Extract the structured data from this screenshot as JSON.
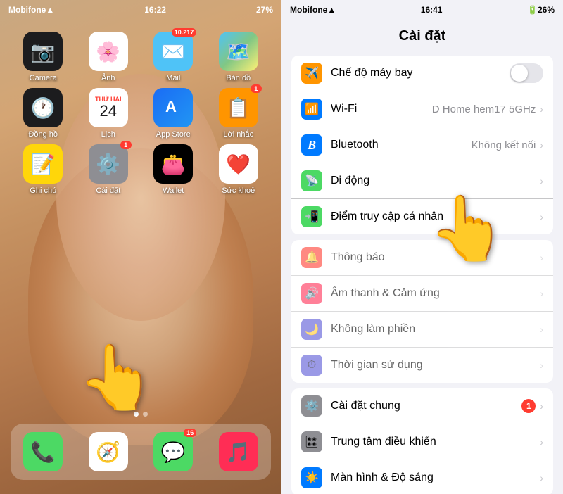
{
  "left": {
    "status": {
      "carrier": "Mobifone",
      "time": "16:22",
      "battery": "27%"
    },
    "apps_row1": [
      {
        "name": "Camera",
        "icon": "📷",
        "style": "icon-camera",
        "badge": ""
      },
      {
        "name": "Ảnh",
        "icon": "🌸",
        "style": "icon-photos",
        "badge": ""
      },
      {
        "name": "Mail",
        "icon": "✉️",
        "style": "icon-mail",
        "badge": "10.217"
      },
      {
        "name": "Bản đồ",
        "icon": "🗺️",
        "style": "icon-maps",
        "badge": ""
      }
    ],
    "apps_row2": [
      {
        "name": "Đồng hồ",
        "icon": "🕐",
        "style": "icon-clock",
        "badge": ""
      },
      {
        "name": "Lịch",
        "icon": "📅",
        "style": "icon-calendar",
        "badge": ""
      },
      {
        "name": "App Store",
        "icon": "🅰",
        "style": "icon-appstore",
        "badge": ""
      },
      {
        "name": "Lời nhắc",
        "icon": "📋",
        "style": "icon-reminders",
        "badge": "1"
      }
    ],
    "apps_row3": [
      {
        "name": "Ghi chú",
        "icon": "📝",
        "style": "icon-notes",
        "badge": ""
      },
      {
        "name": "Cài đặt",
        "icon": "⚙️",
        "style": "icon-settings",
        "badge": "1"
      },
      {
        "name": "Wallet",
        "icon": "👛",
        "style": "icon-wallet",
        "badge": ""
      },
      {
        "name": "Sức khoẻ",
        "icon": "❤️",
        "style": "icon-health",
        "badge": ""
      }
    ],
    "dock": [
      {
        "name": "Phone",
        "icon": "📞",
        "style": "dock-phone",
        "badge": ""
      },
      {
        "name": "Safari",
        "icon": "🧭",
        "style": "dock-safari",
        "badge": ""
      },
      {
        "name": "Messages",
        "icon": "💬",
        "style": "dock-messages",
        "badge": "16"
      },
      {
        "name": "Music",
        "icon": "🎵",
        "style": "dock-music",
        "badge": ""
      }
    ]
  },
  "right": {
    "status": {
      "carrier": "Mobifone",
      "time": "16:41",
      "battery": "26%"
    },
    "title": "Cài đặt",
    "sections": [
      {
        "rows": [
          {
            "icon": "✈️",
            "iconStyle": "ic-airplane",
            "label": "Chế độ máy bay",
            "value": "",
            "type": "toggle"
          },
          {
            "icon": "📶",
            "iconStyle": "ic-wifi",
            "label": "Wi-Fi",
            "value": "D Home hem17 5GHz",
            "type": "nav"
          },
          {
            "icon": "🔵",
            "iconStyle": "ic-bluetooth",
            "label": "Bluetooth",
            "value": "Không kết nối",
            "type": "nav"
          },
          {
            "icon": "📡",
            "iconStyle": "ic-cellular",
            "label": "Di động",
            "value": "",
            "type": "nav"
          },
          {
            "icon": "📲",
            "iconStyle": "ic-hotspot",
            "label": "Điểm truy cập cá nhân",
            "value": "",
            "type": "nav"
          }
        ]
      },
      {
        "rows": [
          {
            "icon": "🔔",
            "iconStyle": "ic-notifications",
            "label": "Thông báo",
            "value": "",
            "type": "nav"
          },
          {
            "icon": "🔊",
            "iconStyle": "ic-sounds",
            "label": "Âm thanh & Cảm ứng",
            "value": "",
            "type": "nav"
          },
          {
            "icon": "🌙",
            "iconStyle": "ic-focus",
            "label": "Không làm phiền",
            "value": "",
            "type": "nav"
          },
          {
            "icon": "⏱",
            "iconStyle": "ic-screentime",
            "label": "Thời gian sử dụng",
            "value": "",
            "type": "nav"
          }
        ]
      },
      {
        "rows": [
          {
            "icon": "⚙️",
            "iconStyle": "ic-general",
            "label": "Cài đặt chung",
            "value": "",
            "type": "nav",
            "badge": "1"
          },
          {
            "icon": "🎛",
            "iconStyle": "ic-control",
            "label": "Trung tâm điều khiển",
            "value": "",
            "type": "nav"
          },
          {
            "icon": "☀️",
            "iconStyle": "ic-display",
            "label": "Màn hình & Độ sáng",
            "value": "",
            "type": "nav"
          }
        ]
      }
    ]
  }
}
